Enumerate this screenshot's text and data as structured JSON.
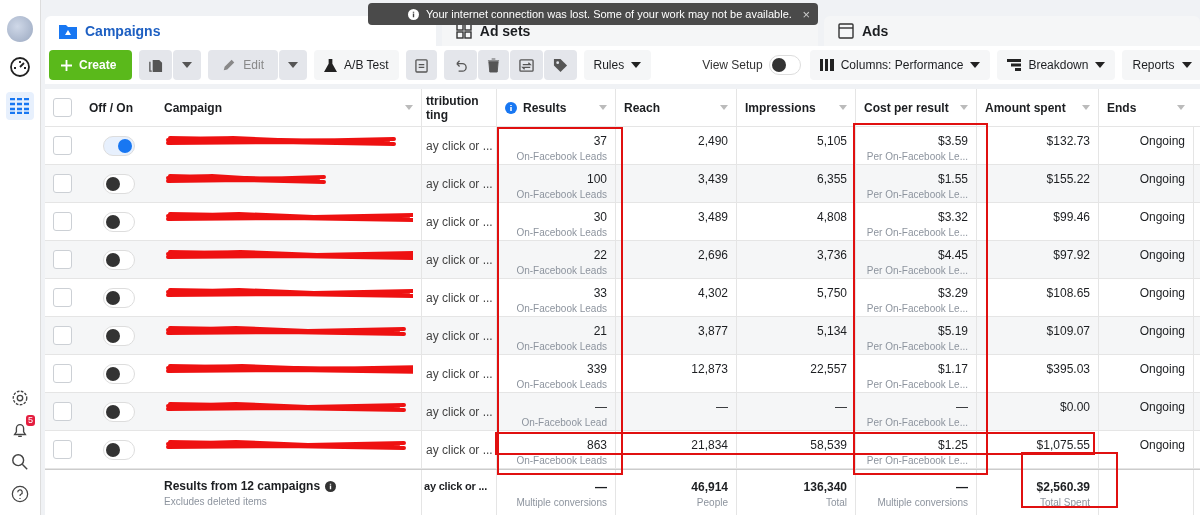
{
  "sidebar": {
    "notification_count": "5"
  },
  "toast": {
    "message": "Your internet connection was lost. Some of your work may not be available.",
    "close": "×"
  },
  "tabs": [
    {
      "label": "Campaigns",
      "selected": true
    },
    {
      "label": "Ad sets",
      "selected": false
    },
    {
      "label": "Ads",
      "selected": false
    }
  ],
  "toolbar": {
    "create": "Create",
    "edit": "Edit",
    "ab_test": "A/B Test",
    "rules": "Rules",
    "view_setup": {
      "label": "View Setup",
      "on": false
    },
    "columns": "Columns: Performance",
    "breakdown": "Breakdown",
    "reports": "Reports"
  },
  "table": {
    "all_selected": false,
    "columns": [
      {
        "label": "Off / On"
      },
      {
        "label": "Campaign"
      },
      {
        "label": "ttribution",
        "label2": "ting"
      },
      {
        "label": "Results",
        "info": true
      },
      {
        "label": "Reach"
      },
      {
        "label": "Impressions"
      },
      {
        "label": "Cost per result"
      },
      {
        "label": "Amount spent"
      },
      {
        "label": "Ends"
      }
    ],
    "rows": [
      {
        "selected": false,
        "on": true,
        "attribution": "ay click or ...",
        "results": "37",
        "results_sub": "On-Facebook Leads",
        "reach": "2,490",
        "impressions": "5,105",
        "cost": "$3.59",
        "cost_sub": "Per On-Facebook Le...",
        "spent": "$132.73",
        "ends": "Ongoing"
      },
      {
        "selected": false,
        "on": false,
        "attribution": "ay click or ...",
        "results": "100",
        "results_sub": "On-Facebook Leads",
        "reach": "3,439",
        "impressions": "6,355",
        "cost": "$1.55",
        "cost_sub": "Per On-Facebook Le...",
        "spent": "$155.22",
        "ends": "Ongoing"
      },
      {
        "selected": false,
        "on": false,
        "attribution": "ay click or ...",
        "results": "30",
        "results_sub": "On-Facebook Leads",
        "reach": "3,489",
        "impressions": "4,808",
        "cost": "$3.32",
        "cost_sub": "Per On-Facebook Le...",
        "spent": "$99.46",
        "ends": "Ongoing"
      },
      {
        "selected": false,
        "on": false,
        "attribution": "ay click or ...",
        "results": "22",
        "results_sub": "On-Facebook Leads",
        "reach": "2,696",
        "impressions": "3,736",
        "cost": "$4.45",
        "cost_sub": "Per On-Facebook Le...",
        "spent": "$97.92",
        "ends": "Ongoing"
      },
      {
        "selected": false,
        "on": false,
        "attribution": "ay click or ...",
        "results": "33",
        "results_sub": "On-Facebook Leads",
        "reach": "4,302",
        "impressions": "5,750",
        "cost": "$3.29",
        "cost_sub": "Per On-Facebook Le...",
        "spent": "$108.65",
        "ends": "Ongoing"
      },
      {
        "selected": false,
        "on": false,
        "attribution": "ay click or ...",
        "results": "21",
        "results_sub": "On-Facebook Leads",
        "reach": "3,877",
        "impressions": "5,134",
        "cost": "$5.19",
        "cost_sub": "Per On-Facebook Le...",
        "spent": "$109.07",
        "ends": "Ongoing"
      },
      {
        "selected": false,
        "on": false,
        "attribution": "ay click or ...",
        "results": "339",
        "results_sub": "On-Facebook Leads",
        "reach": "12,873",
        "impressions": "22,557",
        "cost": "$1.17",
        "cost_sub": "Per On-Facebook Le...",
        "spent": "$395.03",
        "ends": "Ongoing"
      },
      {
        "selected": false,
        "on": false,
        "attribution": "ay click or ...",
        "results": "—",
        "results_sub": "On-Facebook Lead",
        "reach": "—",
        "impressions": "—",
        "cost": "—",
        "cost_sub": "Per On-Facebook Le...",
        "spent": "$0.00",
        "ends": "Ongoing"
      },
      {
        "selected": false,
        "on": false,
        "attribution": "ay click or ...",
        "results": "863",
        "results_sub": "On-Facebook Leads",
        "reach": "21,834",
        "impressions": "58,539",
        "cost": "$1.25",
        "cost_sub": "Per On-Facebook Le...",
        "spent": "$1,075.55",
        "ends": "Ongoing"
      }
    ],
    "summary": {
      "title": "Results from 12 campaigns",
      "subtitle": "Excludes deleted items",
      "attribution": "ay click or ...",
      "results": "—",
      "results_sub": "Multiple conversions",
      "reach": "46,914",
      "reach_sub": "People",
      "impressions": "136,340",
      "impressions_sub": "Total",
      "cost": "—",
      "cost_sub": "Multiple conversions",
      "spent": "$2,560.39",
      "spent_sub": "Total Spent"
    }
  }
}
